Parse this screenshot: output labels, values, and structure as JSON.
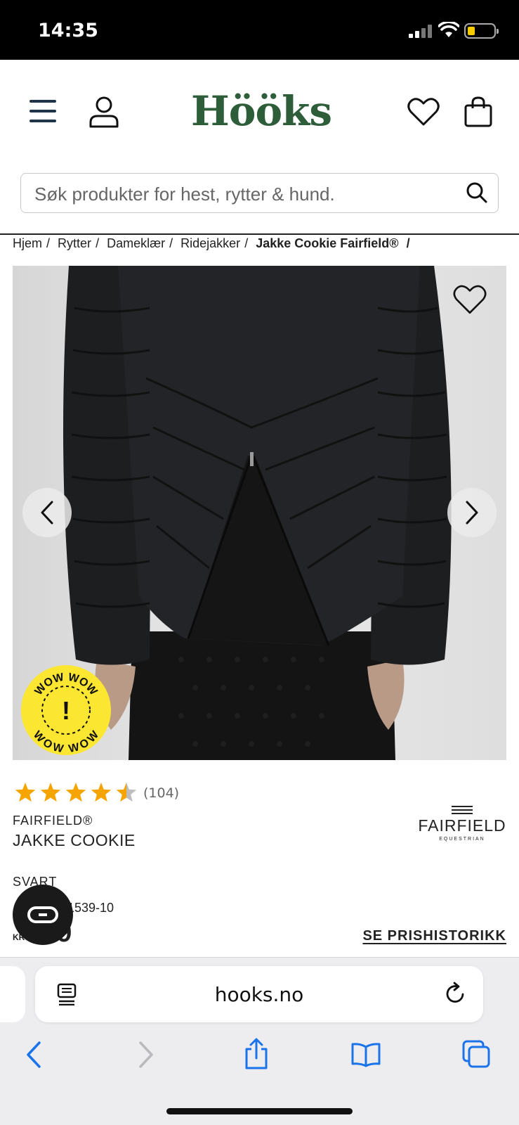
{
  "status": {
    "time": "14:35"
  },
  "header": {
    "logo": "Hööks"
  },
  "search": {
    "placeholder": "Søk produkter for hest, rytter & hund."
  },
  "breadcrumb": {
    "items": [
      "Hjem",
      "Rytter",
      "Dameklær",
      "Ridejakker"
    ],
    "current": "Jakke Cookie Fairfield®",
    "separator": "/"
  },
  "badge": {
    "text": "WOW WOW",
    "mark": "!"
  },
  "rating": {
    "value": 4.5,
    "max": 5,
    "count": "(104)",
    "color": "#f6a400"
  },
  "product": {
    "brand": "FAIRFIELD®",
    "name": "JAKKE COOKIE",
    "color": "SVART",
    "article_no": "1539-10",
    "currency": "KR",
    "price": "49",
    "price_history": "SE PRISHISTORIKK"
  },
  "brand_logo": {
    "word": "FAIRFIELD",
    "sub": "EQUESTRIAN"
  },
  "browser": {
    "url": "hooks.no"
  },
  "colors": {
    "logo_green": "#2e5d3a",
    "menu_navy": "#1f3448",
    "badge_yellow": "#fbe631",
    "star": "#f6a400"
  }
}
